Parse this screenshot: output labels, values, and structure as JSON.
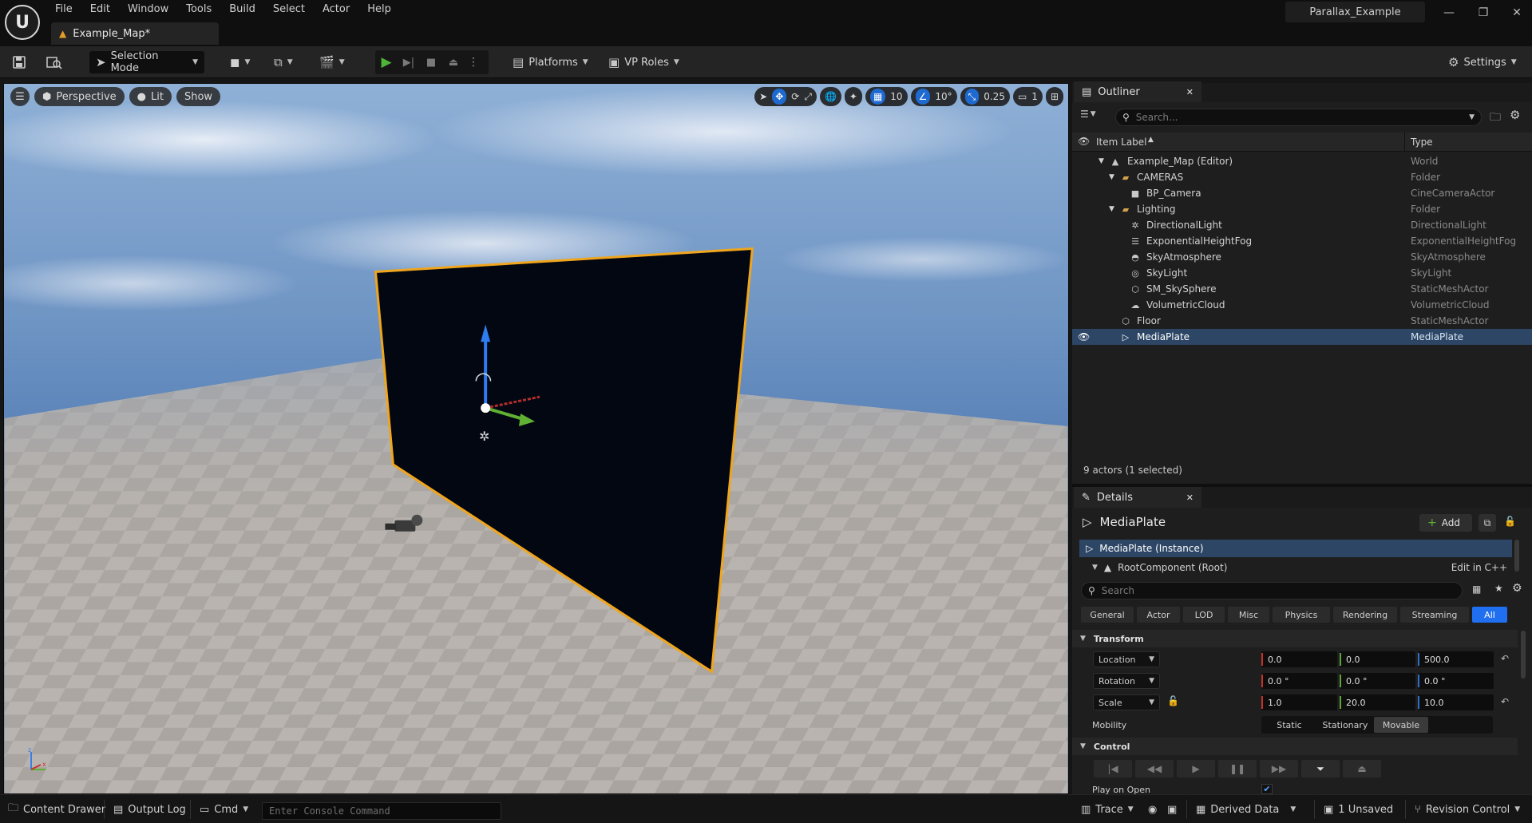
{
  "app": {
    "logo_text": "U",
    "project_name": "Parallax_Example",
    "menu": [
      "File",
      "Edit",
      "Window",
      "Tools",
      "Build",
      "Select",
      "Actor",
      "Help"
    ],
    "document_tab": "Example_Map*"
  },
  "toolbar": {
    "mode_label": "Selection Mode",
    "platforms_label": "Platforms",
    "vp_roles_label": "VP Roles",
    "settings_label": "Settings"
  },
  "viewport": {
    "perspective_label": "Perspective",
    "lit_label": "Lit",
    "show_label": "Show",
    "grid_snap": "10",
    "rotation_snap": "10°",
    "scale_snap": "0.25",
    "camera_speed": "1",
    "colors": {
      "plate_outline": "#f0a51c",
      "plate_fill": "#020712"
    }
  },
  "outliner": {
    "tab_label": "Outliner",
    "search_placeholder": "Search...",
    "col_item_label": "Item Label",
    "col_type": "Type",
    "rows": [
      {
        "label": "Example_Map (Editor)",
        "type": "World"
      },
      {
        "label": "CAMERAS",
        "type": "Folder"
      },
      {
        "label": "BP_Camera",
        "type": "CineCameraActor"
      },
      {
        "label": "Lighting",
        "type": "Folder"
      },
      {
        "label": "DirectionalLight",
        "type": "DirectionalLight"
      },
      {
        "label": "ExponentialHeightFog",
        "type": "ExponentialHeightFog"
      },
      {
        "label": "SkyAtmosphere",
        "type": "SkyAtmosphere"
      },
      {
        "label": "SkyLight",
        "type": "SkyLight"
      },
      {
        "label": "SM_SkySphere",
        "type": "StaticMeshActor"
      },
      {
        "label": "VolumetricCloud",
        "type": "VolumetricCloud"
      },
      {
        "label": "Floor",
        "type": "StaticMeshActor"
      },
      {
        "label": "MediaPlate",
        "type": "MediaPlate"
      }
    ],
    "footer": "9 actors (1 selected)"
  },
  "details": {
    "tab_label": "Details",
    "actor_name": "MediaPlate",
    "add_label": "Add",
    "instance_label": "MediaPlate (Instance)",
    "root_component": "RootComponent (Root)",
    "edit_cpp": "Edit in C++",
    "search_placeholder": "Search",
    "filters": [
      "General",
      "Actor",
      "LOD",
      "Misc",
      "Physics",
      "Rendering",
      "Streaming",
      "All"
    ],
    "transform_section": "Transform",
    "location": {
      "label": "Location",
      "x": "0.0",
      "y": "0.0",
      "z": "500.0"
    },
    "rotation": {
      "label": "Rotation",
      "x": "0.0 °",
      "y": "0.0 °",
      "z": "0.0 °"
    },
    "scale": {
      "label": "Scale",
      "x": "1.0",
      "y": "20.0",
      "z": "10.0"
    },
    "mobility_label": "Mobility",
    "mobility_options": [
      "Static",
      "Stationary",
      "Movable"
    ],
    "mobility_selected": "Movable",
    "control_section": "Control",
    "play_on_open_label": "Play on Open"
  },
  "statusbar": {
    "content_drawer": "Content Drawer",
    "output_log": "Output Log",
    "cmd": "Cmd",
    "console_placeholder": "Enter Console Command",
    "trace": "Trace",
    "derived_data": "Derived Data",
    "unsaved": "1 Unsaved",
    "revision_control": "Revision Control"
  }
}
